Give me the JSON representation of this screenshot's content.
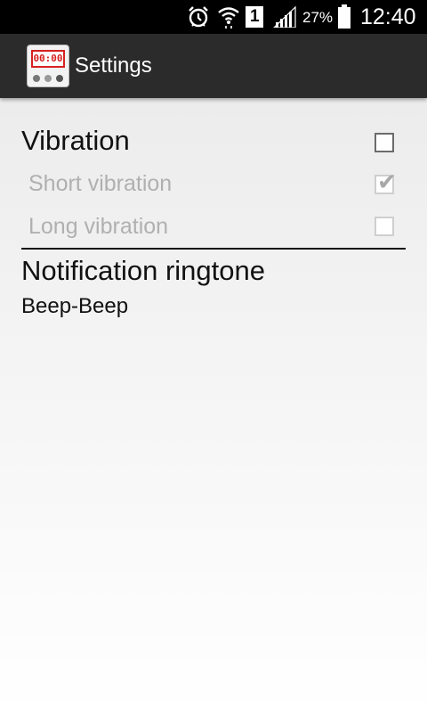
{
  "status_bar": {
    "battery_percent": "27%",
    "sim_slot": "1",
    "time": "12:40",
    "icons": [
      "alarm-icon",
      "wifi-icon",
      "sim-icon",
      "signal-icon",
      "battery-icon"
    ]
  },
  "action_bar": {
    "title": "Settings",
    "app_icon_display": "00:00",
    "app_icon_name": "stopwatch-app-icon"
  },
  "settings": {
    "vibration": {
      "title": "Vibration",
      "checked": false,
      "enabled": true
    },
    "short_vibration": {
      "title": "Short vibration",
      "checked": true,
      "enabled": false
    },
    "long_vibration": {
      "title": "Long vibration",
      "checked": false,
      "enabled": false
    },
    "ringtone": {
      "title": "Notification ringtone",
      "summary": "Beep-Beep"
    }
  },
  "colors": {
    "status_bar": "#000000",
    "action_bar": "#2b2b2b",
    "disabled_text": "#b0b0b0",
    "icon_red": "#d82020"
  }
}
